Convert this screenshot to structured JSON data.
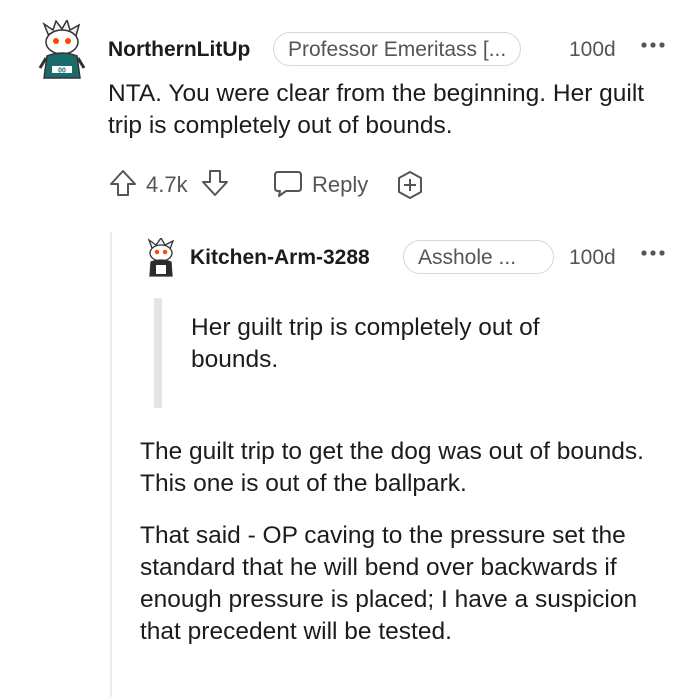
{
  "comment1": {
    "username": "NorthernLitUp",
    "flair": "Professor Emeritass [...",
    "age": "100d",
    "more_icon": "more-dots-icon",
    "body": "NTA. You were clear from the beginning. Her guilt trip is completely out of bounds.",
    "score": "4.7k",
    "reply_label": "Reply",
    "icons": [
      "upvote-icon",
      "downvote-icon",
      "reply-icon",
      "award-icon"
    ]
  },
  "comment2": {
    "username": "Kitchen-Arm-3288",
    "flair": "Asshole ...",
    "age": "100d",
    "quote": "Her guilt trip is completely out of bounds.",
    "paragraph1": "The guilt trip to get the dog was out of bounds. This one is out of the ballpark.",
    "paragraph2": "That said - OP caving to the pressure set the standard that he will bend over backwards if enough pressure is placed; I have a suspicion that precedent will be tested."
  },
  "colors": {
    "text": "#1c1c1c",
    "meta": "#555555",
    "border": "#d6d6d6",
    "quote_bar": "#e5e5e5"
  }
}
